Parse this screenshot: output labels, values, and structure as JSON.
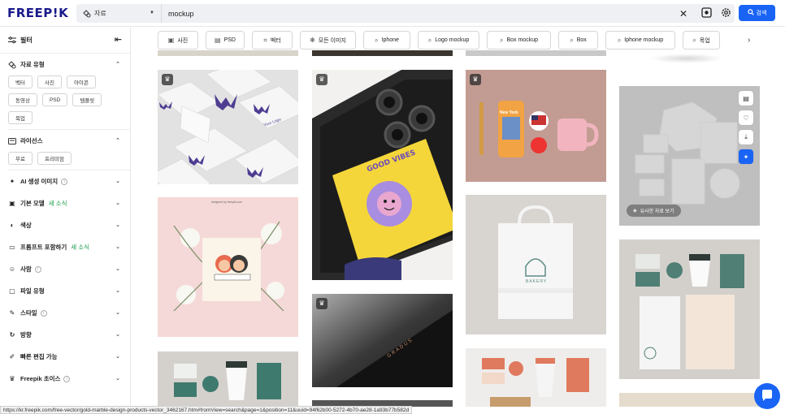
{
  "logo": "FREEP!K",
  "search": {
    "type_label": "자료",
    "query": "mockup",
    "button_label": "검색"
  },
  "sidebar": {
    "filter_title": "필터",
    "asset_type": {
      "title": "자료 유형",
      "chips": [
        "벡터",
        "사진",
        "아이콘",
        "동영상",
        "PSD",
        "템플릿",
        "목업"
      ]
    },
    "license": {
      "title": "라이선스",
      "chips": [
        "무료",
        "프리미엄"
      ]
    },
    "sections": [
      {
        "title": "AI 생성 이미지",
        "info": "i",
        "new": ""
      },
      {
        "title": "기본 모델",
        "info": "",
        "new": "새 소식"
      },
      {
        "title": "색상",
        "info": "",
        "new": ""
      },
      {
        "title": "프롬프트 포함하기",
        "info": "",
        "new": "새 소식"
      },
      {
        "title": "사람",
        "info": "i",
        "new": ""
      },
      {
        "title": "파일 유형",
        "info": "",
        "new": ""
      },
      {
        "title": "스타일",
        "info": "i",
        "new": ""
      },
      {
        "title": "방향",
        "info": "",
        "new": ""
      },
      {
        "title": "빠른 편집 가능",
        "info": "",
        "new": ""
      },
      {
        "title": "Freepik 초이스",
        "info": "i",
        "new": ""
      }
    ]
  },
  "pills": [
    {
      "label": "사진",
      "icon": "image-icon"
    },
    {
      "label": "PSD",
      "icon": "psd-icon"
    },
    {
      "label": "벡터",
      "icon": "vector-icon"
    },
    {
      "label": "모든 이미지",
      "icon": "all-images-icon"
    },
    {
      "label": "Iphone",
      "icon": "search-icon"
    },
    {
      "label": "Logo mockup",
      "icon": "search-icon"
    },
    {
      "label": "Box mockup",
      "icon": "search-icon"
    },
    {
      "label": "Box",
      "icon": "search-icon"
    },
    {
      "label": "Iphone mockup",
      "icon": "search-icon"
    },
    {
      "label": "목업",
      "icon": "search-icon"
    }
  ],
  "tiles": {
    "business_cards": {
      "text": "Your Logo"
    },
    "phone": {
      "text": "GOOD VIBES"
    },
    "tote": {
      "text": "New York"
    },
    "bag": {
      "text": "BAKERY"
    },
    "invitation": {
      "text": "designed by freepik.com"
    },
    "black_book": {
      "text": "GRADUS"
    },
    "similar_button": "유사한 자료 보기"
  },
  "status_url": "https://kr.freepik.com/free-vector/gold-marble-design-products-vector_3462167.htm#fromView=search&page=1&position=11&uuid=94f62b00-5272-4b70-ae28-1a93b77b582d",
  "colors": {
    "brand": "#1a1a8c",
    "accent": "#1a64f5",
    "new_badge": "#1e9e4a"
  }
}
